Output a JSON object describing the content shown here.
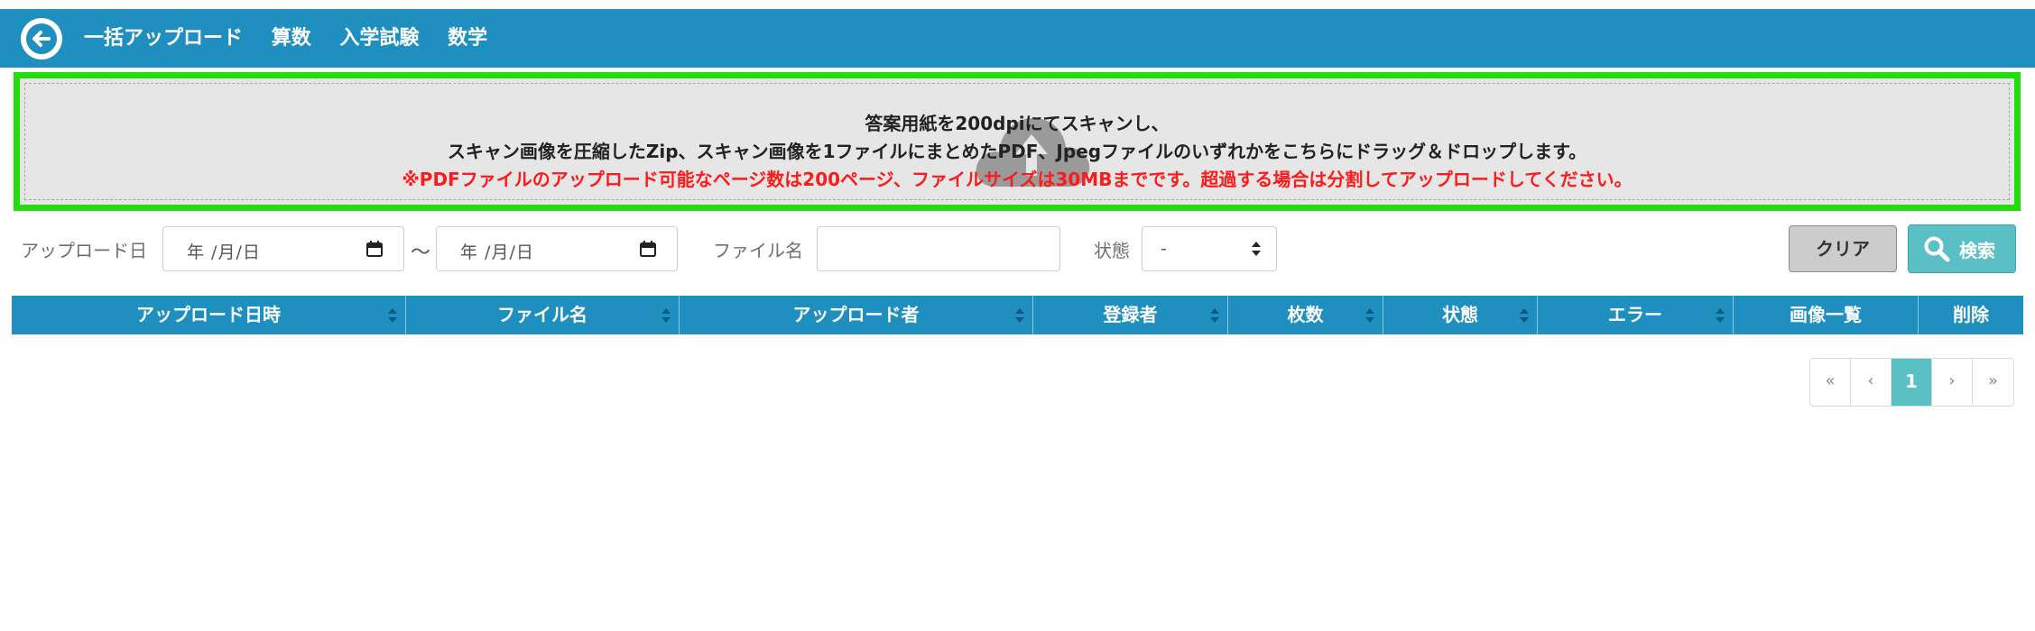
{
  "header": {
    "title_parts": [
      "一括アップロード",
      "算数",
      "入学試験",
      "数学"
    ]
  },
  "dropzone": {
    "line1": "答案用紙を200dpiにてスキャンし、",
    "line2": "スキャン画像を圧縮したZip、スキャン画像を1ファイルにまとめたPDF、Jpegファイルのいずれかをこちらにドラッグ＆ドロップします。",
    "line3": "※PDFファイルのアップロード可能なページ数は200ページ、ファイルサイズは30MBまでです。超過する場合は分割してアップロードしてください。",
    "icon": "cloud-upload-icon"
  },
  "filters": {
    "upload_date_label": "アップロード日",
    "date_from_placeholder": "年 /月/日",
    "range_separator": "〜",
    "date_to_placeholder": "年 /月/日",
    "file_name_label": "ファイル名",
    "file_name_value": "",
    "status_label": "状態",
    "status_selected": "-",
    "clear_label": "クリア",
    "search_label": "検索"
  },
  "table": {
    "columns": [
      "アップロード日時",
      "ファイル名",
      "アップロード者",
      "登録者",
      "枚数",
      "状態",
      "エラー",
      "画像一覧",
      "削除"
    ],
    "rows": []
  },
  "pagination": {
    "first": "«",
    "prev": "‹",
    "current": "1",
    "next": "›",
    "last": "»"
  },
  "colors": {
    "header_bg": "#1e8fbf",
    "dropzone_border": "#22dd0b",
    "warning_text": "#ff1a1a",
    "search_button": "#5bc0c5"
  }
}
